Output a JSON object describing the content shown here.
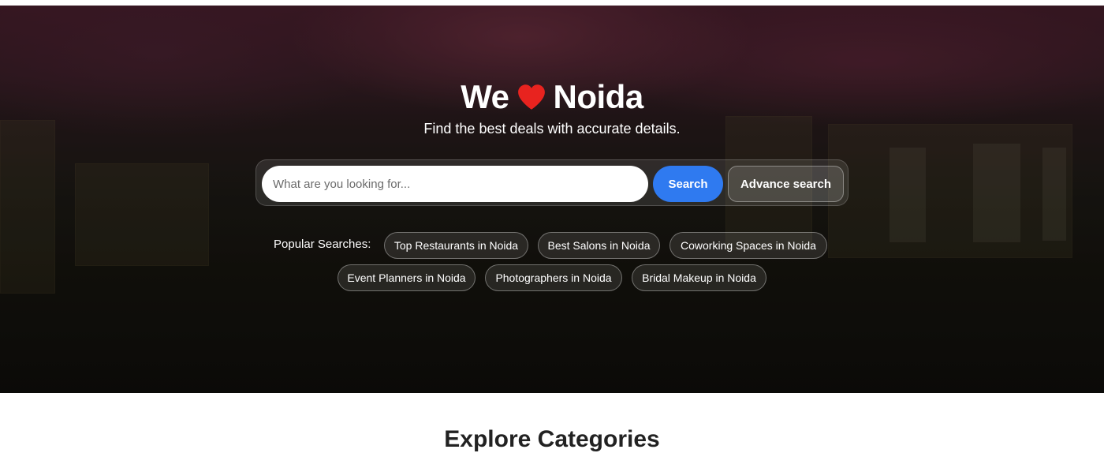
{
  "hero": {
    "title_before": "We",
    "title_after": "Noida",
    "heart_icon": "heart-icon",
    "heart_color": "#e8231f",
    "subtitle": "Find the best deals with accurate details."
  },
  "search": {
    "placeholder": "What are you looking for...",
    "value": "",
    "search_label": "Search",
    "advance_label": "Advance search",
    "accent_color": "#2f7af0"
  },
  "popular": {
    "label": "Popular Searches:",
    "items": [
      "Top Restaurants in Noida",
      "Best Salons in Noida",
      "Coworking Spaces in Noida",
      "Event Planners in Noida",
      "Photographers in Noida",
      "Bridal Makeup in Noida"
    ]
  },
  "section": {
    "title": "Explore Categories"
  }
}
